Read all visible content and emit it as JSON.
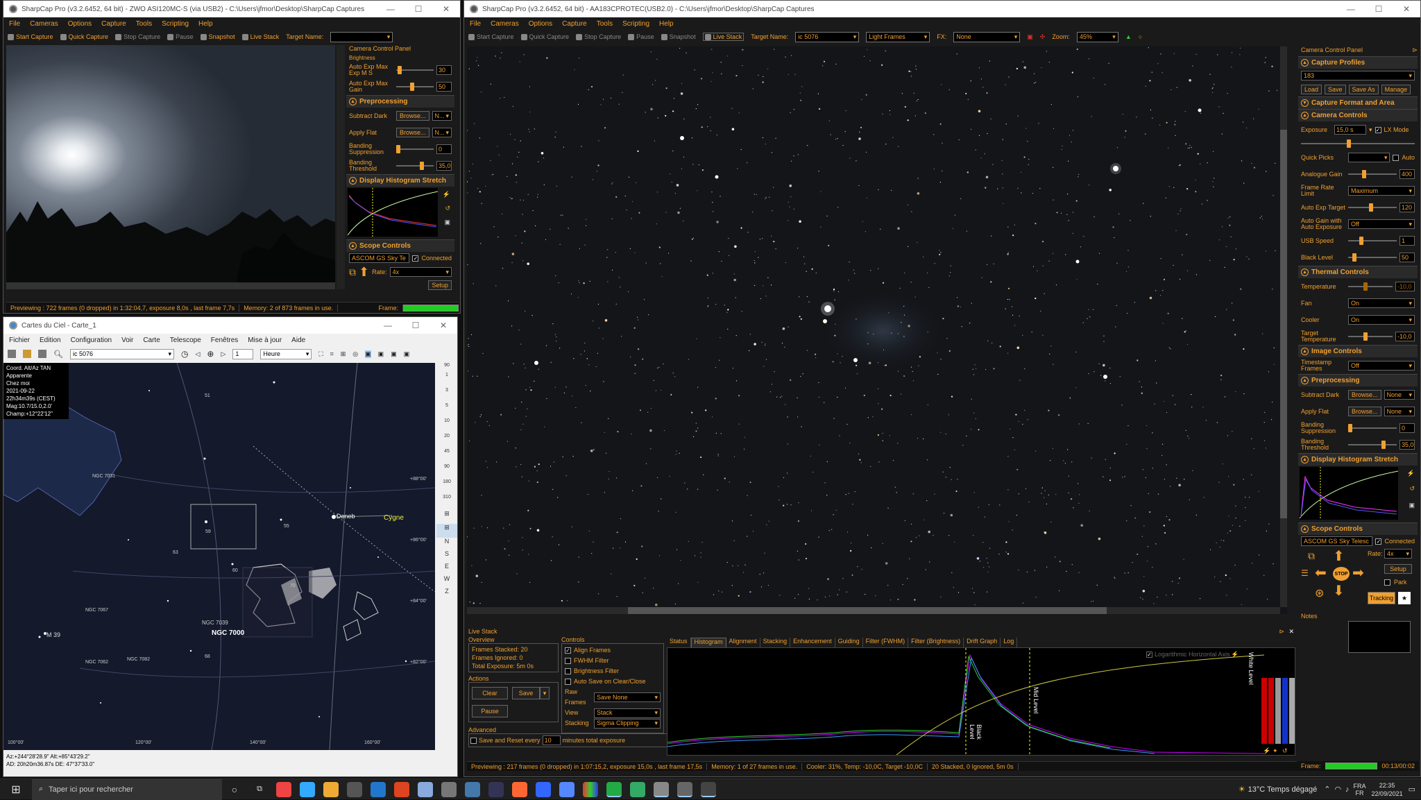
{
  "win1": {
    "title": "SharpCap Pro (v3.2.6452, 64 bit) - ZWO ASI120MC-S (via USB2) - C:\\Users\\jfmor\\Desktop\\SharpCap Captures",
    "menu": [
      "File",
      "Cameras",
      "Options",
      "Capture",
      "Tools",
      "Scripting",
      "Help"
    ],
    "toolbar": [
      "Start Capture",
      "Quick Capture",
      "Stop Capture",
      "Pause",
      "Snapshot",
      "Live Stack",
      "Target Name:"
    ],
    "status": [
      "Previewing : 722 frames (0 dropped) in 1:32:04,7, exposure 8,0s , last frame 7,7s",
      "Memory: 2 of 873 frames in use.",
      "Frame:"
    ],
    "panel": {
      "title": "Camera Control Panel",
      "brightness": "Brightness",
      "auto_exp_max": "Auto Exp Max Exp M S",
      "auto_exp_max_val": "30",
      "auto_exp_gain": "Auto Exp Max Gain",
      "auto_exp_gain_val": "50",
      "preprocessing": "Preprocessing",
      "subtract_dark": "Subtract Dark",
      "apply_flat": "Apply Flat",
      "browse": "Browse...",
      "none_short": "N...",
      "banding_suppression": "Banding Suppression",
      "banding_suppression_val": "0",
      "banding_threshold": "Banding Threshold",
      "banding_threshold_val": "35,0",
      "histogram": "Display Histogram Stretch",
      "scope": "Scope Controls",
      "ascom": "ASCOM GS Sky Te",
      "connected": "Connected",
      "rate": "Rate:",
      "rate_val": "4x",
      "setup": "Setup"
    }
  },
  "win2": {
    "title": "Cartes du Ciel - Carte_1",
    "menu": [
      "Fichier",
      "Edition",
      "Configuration",
      "Voir",
      "Carte",
      "Telescope",
      "Fenêtres",
      "Mise à jour",
      "Aide"
    ],
    "search": "ic 5076",
    "time_step": "1",
    "time_unit": "Heure",
    "info": [
      "Coord. Alt/Az TAN",
      "Apparente",
      "Chez moi",
      "2021-09-22",
      "22h34m39s (CEST)",
      "Mag:10.7/15.0,2.0'",
      "Champ:+12°22'12\""
    ],
    "labels": [
      "NGC 7031",
      "Deneb",
      "Cygne",
      "NGC 7067",
      "NGC 7039",
      "NGC 7000",
      "M 39",
      "NGC 7062",
      "NGC 7082",
      "51",
      "55",
      "59",
      "60",
      "63",
      "68",
      "70"
    ],
    "decl": [
      "+88°00'",
      "+86°00'",
      "+84°00'",
      "+82°00'"
    ],
    "ra": [
      "120°00'",
      "140°00'",
      "160°00'",
      "100°00'"
    ],
    "side_scale": [
      "90",
      "1",
      "3",
      "5",
      "10",
      "20",
      "45",
      "90",
      "180",
      "310"
    ],
    "side_letters": [
      "N",
      "S",
      "E",
      "W",
      "Z"
    ],
    "footer1": "Az:+244°28'28.9\" Alt:+85°43'29.2\"",
    "footer2": "AD: 20h20m36.87s DE: 47°37'33.0\""
  },
  "win3": {
    "title": "SharpCap Pro (v3.2.6452, 64 bit) - AA183CPROTEC(USB2.0) - C:\\Users\\jfmor\\Desktop\\SharpCap Captures",
    "menu": [
      "File",
      "Cameras",
      "Options",
      "Capture",
      "Tools",
      "Scripting",
      "Help"
    ],
    "toolbar": [
      "Start Capture",
      "Quick Capture",
      "Stop Capture",
      "Pause",
      "Snapshot",
      "Live Stack",
      "Target Name:"
    ],
    "target_name": "ic 5076",
    "frame_type": "Light Frames",
    "fx_label": "FX:",
    "fx_val": "None",
    "zoom_label": "Zoom:",
    "zoom_val": "45%",
    "livestack": {
      "title": "Live Stack",
      "overview": "Overview",
      "frames_stacked": "Frames Stacked: 20",
      "frames_ignored": "Frames Ignored: 0",
      "total_exposure": "Total Exposure: 5m 0s",
      "actions": "Actions",
      "clear": "Clear",
      "save": "Save",
      "pause": "Pause",
      "advanced": "Advanced",
      "save_reset": "Save and Reset every",
      "save_reset_val": "10",
      "minutes": "minutes total exposure",
      "controls": "Controls",
      "align": "Align Frames",
      "fwhm": "FWHM Filter",
      "brightness": "Brightness Filter",
      "autosave": "Auto Save on Clear/Close",
      "raw_frames": "Raw Frames",
      "raw_val": "Save None",
      "view": "View",
      "view_val": "Stack",
      "stacking": "Stacking",
      "stacking_val": "Sigma Clipping",
      "tabs": [
        "Status",
        "Histogram",
        "Alignment",
        "Stacking",
        "Enhancement",
        "Guiding",
        "Filter (FWHM)",
        "Filter (Brightness)",
        "Drift Graph",
        "Log"
      ],
      "log_axis": "Logarithmic Horizontal Axis",
      "black_level": "Black Level",
      "mid_level": "Mid Level",
      "white_level": "White Level"
    },
    "status": [
      "Previewing : 217 frames (0 dropped) in 1:07:15,2, exposure 15,0s , last frame 17,5s",
      "Memory: 1 of 27 frames in use.",
      "Cooler: 31%, Temp: -10,0C, Target -10,0C",
      "20 Stacked, 0 Ignored, 5m 0s"
    ],
    "frame_label": "Frame:",
    "elapsed": "00:13/00:02",
    "panel": {
      "title": "Camera Control Panel",
      "capture_profiles": "Capture Profiles",
      "profile_val": "183",
      "load": "Load",
      "save": "Save",
      "save_as": "Save As",
      "manage": "Manage",
      "capture_format": "Capture Format and Area",
      "camera_controls": "Camera Controls",
      "exposure": "Exposure",
      "exposure_val": "15,0 s",
      "lx_mode": "LX Mode",
      "quick_picks": "Quick Picks",
      "auto": "Auto",
      "analogue_gain": "Analogue Gain",
      "analogue_gain_val": "400",
      "frame_rate": "Frame Rate Limit",
      "frame_rate_val": "Maximum",
      "auto_exp_target": "Auto Exp Target",
      "auto_exp_target_val": "120",
      "auto_gain": "Auto Gain with Auto Exposure",
      "auto_gain_val": "Off",
      "usb_speed": "USB Speed",
      "usb_speed_val": "1",
      "black_level": "Black Level",
      "black_level_val": "50",
      "thermal": "Thermal Controls",
      "temperature": "Temperature",
      "temperature_val": "-10,0",
      "fan": "Fan",
      "fan_val": "On",
      "cooler": "Cooler",
      "cooler_val": "On",
      "target_temp": "Target Temperature",
      "target_temp_val": "-10,0",
      "image_controls": "Image Controls",
      "timestamp": "Timestamp Frames",
      "timestamp_val": "Off",
      "preprocessing": "Preprocessing",
      "subtract_dark": "Subtract Dark",
      "apply_flat": "Apply Flat",
      "browse": "Browse...",
      "none": "None",
      "banding_suppression": "Banding Suppression",
      "banding_suppression_val": "0",
      "banding_threshold": "Banding Threshold",
      "banding_threshold_val": "35,0",
      "histogram": "Display Histogram Stretch",
      "scope": "Scope Controls",
      "ascom": "ASCOM GS Sky Telesc",
      "connected": "Connected",
      "rate": "Rate:",
      "rate_val": "4x",
      "setup": "Setup",
      "stop": "STOP",
      "park": "Park",
      "tracking": "Tracking",
      "notes": "Notes"
    }
  },
  "taskbar": {
    "search": "Taper ici pour rechercher",
    "weather": "13°C  Temps dégagé",
    "lang1": "FRA",
    "lang2": "FR",
    "time": "22:35",
    "date": "22/09/2021"
  },
  "colors": {
    "accent": "#f0a030",
    "panel": "#1a1a1a",
    "sky": "#121828"
  }
}
